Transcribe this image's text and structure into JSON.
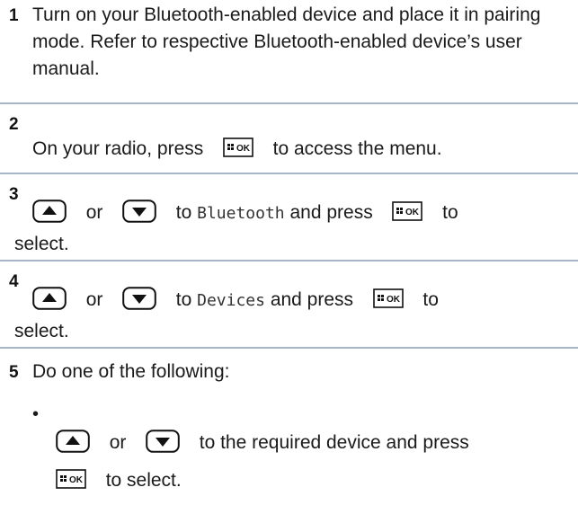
{
  "steps": [
    {
      "number": "1",
      "text": "Turn on your Bluetooth-enabled device and place it in pairing mode. Refer to respective Bluetooth-enabled device’s user manual."
    },
    {
      "number": "2",
      "pre": "On your radio, press",
      "post": "to access the menu."
    },
    {
      "number": "3",
      "or": "or",
      "to": "to",
      "menu_item": "Bluetooth",
      "and_press": "and press",
      "post": "to",
      "post2": "select."
    },
    {
      "number": "4",
      "or": "or",
      "to": "to",
      "menu_item": "Devices",
      "and_press": "and press",
      "post": "to",
      "post2": "select."
    },
    {
      "number": "5",
      "text": "Do one of the following:"
    }
  ],
  "bullet": {
    "symbol": "•",
    "or": "or",
    "text": "to the required device and press",
    "post": "to select."
  },
  "icons": {
    "up": "up-arrow-button-icon",
    "down": "down-arrow-button-icon",
    "ok": "menu-ok-button-icon",
    "ok_label": "OK"
  },
  "colors": {
    "divider": "#a8b4c8"
  }
}
